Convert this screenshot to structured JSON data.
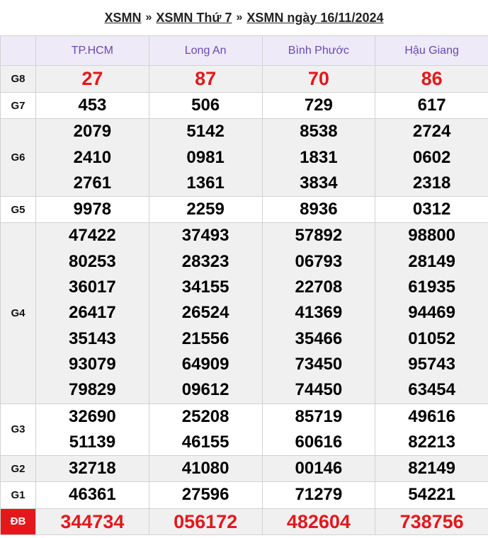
{
  "breadcrumb": {
    "items": [
      "XSMN",
      "XSMN Thứ 7",
      "XSMN ngày 16/11/2024"
    ],
    "separator": "»"
  },
  "provinces": [
    "TP.HCM",
    "Long An",
    "Bình Phước",
    "Hậu Giang"
  ],
  "prizes": [
    {
      "label": "G8",
      "shade": "alt",
      "highlight": true,
      "values": [
        [
          "27"
        ],
        [
          "87"
        ],
        [
          "70"
        ],
        [
          "86"
        ]
      ]
    },
    {
      "label": "G7",
      "shade": "plain",
      "highlight": false,
      "values": [
        [
          "453"
        ],
        [
          "506"
        ],
        [
          "729"
        ],
        [
          "617"
        ]
      ]
    },
    {
      "label": "G6",
      "shade": "alt",
      "highlight": false,
      "values": [
        [
          "2079",
          "2410",
          "2761"
        ],
        [
          "5142",
          "0981",
          "1361"
        ],
        [
          "8538",
          "1831",
          "3834"
        ],
        [
          "2724",
          "0602",
          "2318"
        ]
      ]
    },
    {
      "label": "G5",
      "shade": "plain",
      "highlight": false,
      "values": [
        [
          "9978"
        ],
        [
          "2259"
        ],
        [
          "8936"
        ],
        [
          "0312"
        ]
      ]
    },
    {
      "label": "G4",
      "shade": "alt",
      "highlight": false,
      "values": [
        [
          "47422",
          "80253",
          "36017",
          "26417",
          "35143",
          "93079",
          "79829"
        ],
        [
          "37493",
          "28323",
          "34155",
          "26524",
          "21556",
          "64909",
          "09612"
        ],
        [
          "57892",
          "06793",
          "22708",
          "41369",
          "35466",
          "73450",
          "74450"
        ],
        [
          "98800",
          "28149",
          "61935",
          "94469",
          "01052",
          "95743",
          "63454"
        ]
      ]
    },
    {
      "label": "G3",
      "shade": "plain",
      "highlight": false,
      "values": [
        [
          "32690",
          "51139"
        ],
        [
          "25208",
          "46155"
        ],
        [
          "85719",
          "60616"
        ],
        [
          "49616",
          "82213"
        ]
      ]
    },
    {
      "label": "G2",
      "shade": "alt",
      "highlight": false,
      "values": [
        [
          "32718"
        ],
        [
          "41080"
        ],
        [
          "00146"
        ],
        [
          "82149"
        ]
      ]
    },
    {
      "label": "G1",
      "shade": "plain",
      "highlight": false,
      "values": [
        [
          "46361"
        ],
        [
          "27596"
        ],
        [
          "71279"
        ],
        [
          "54221"
        ]
      ]
    },
    {
      "label": "ĐB",
      "shade": "alt",
      "highlight": true,
      "special": true,
      "values": [
        [
          "344734"
        ],
        [
          "056172"
        ],
        [
          "482604"
        ],
        [
          "738756"
        ]
      ]
    }
  ],
  "colors": {
    "header_bg": "#eeeaf7",
    "header_text": "#6a48b4",
    "highlight_red": "#e4181c",
    "row_alt": "#f0f0f0"
  }
}
